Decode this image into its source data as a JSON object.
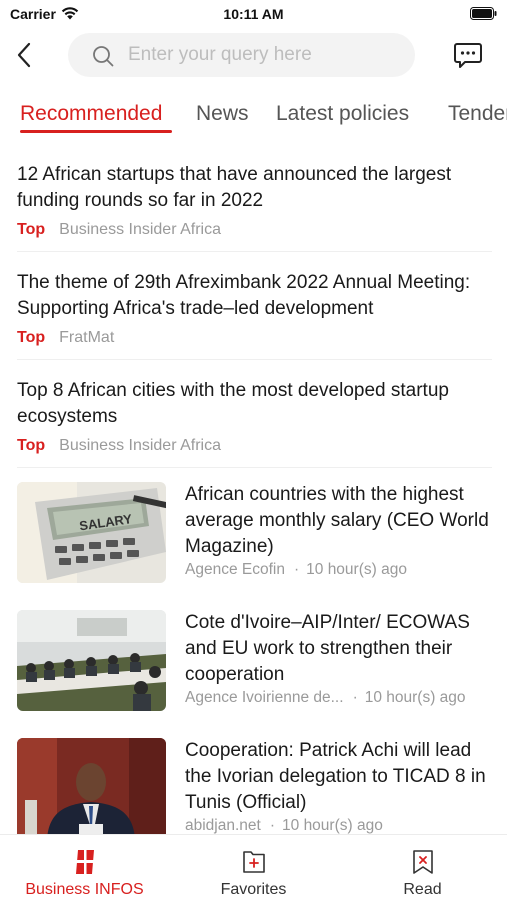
{
  "status_bar": {
    "carrier": "Carrier",
    "time": "10:11 AM"
  },
  "search": {
    "placeholder": "Enter your query here",
    "value": ""
  },
  "tabs": [
    {
      "label": "Recommended",
      "active": true
    },
    {
      "label": "News",
      "active": false
    },
    {
      "label": "Latest policies",
      "active": false
    },
    {
      "label": "Tenders",
      "active": false
    }
  ],
  "text_news": [
    {
      "title": "12 African startups that have announced the largest funding rounds so far in 2022",
      "badge": "Top",
      "source": "Business Insider Africa"
    },
    {
      "title": "The theme of 29th Afreximbank 2022 Annual Meeting: Supporting Africa's trade–led development",
      "badge": "Top",
      "source": "FratMat"
    },
    {
      "title": "Top 8 African cities with the most developed startup ecosystems",
      "badge": "Top",
      "source": "Business Insider Africa"
    }
  ],
  "image_news": [
    {
      "title": "African countries with the highest average monthly salary (CEO World Magazine)",
      "source": "Agence Ecofin",
      "time": "10 hour(s) ago",
      "thumb_text": "SALARY"
    },
    {
      "title": "Cote d'Ivoire–AIP/Inter/ ECOWAS and EU work to strengthen their cooperation",
      "source": "Agence Ivoirienne de...",
      "time": "10 hour(s) ago"
    },
    {
      "title": "Cooperation: Patrick Achi will lead the Ivorian delegation to TICAD 8 in Tunis (Official)",
      "source": "abidjan.net",
      "time": "10 hour(s) ago"
    }
  ],
  "meta_separator": "·",
  "bottom_nav": [
    {
      "label": "Business INFOS",
      "icon": "business-infos-icon",
      "active": true
    },
    {
      "label": "Favorites",
      "icon": "favorites-icon",
      "active": false
    },
    {
      "label": "Read",
      "icon": "read-icon",
      "active": false
    }
  ],
  "colors": {
    "accent": "#d8201f",
    "meta": "#9a9a9a",
    "search_bg": "#f3f3f3"
  }
}
